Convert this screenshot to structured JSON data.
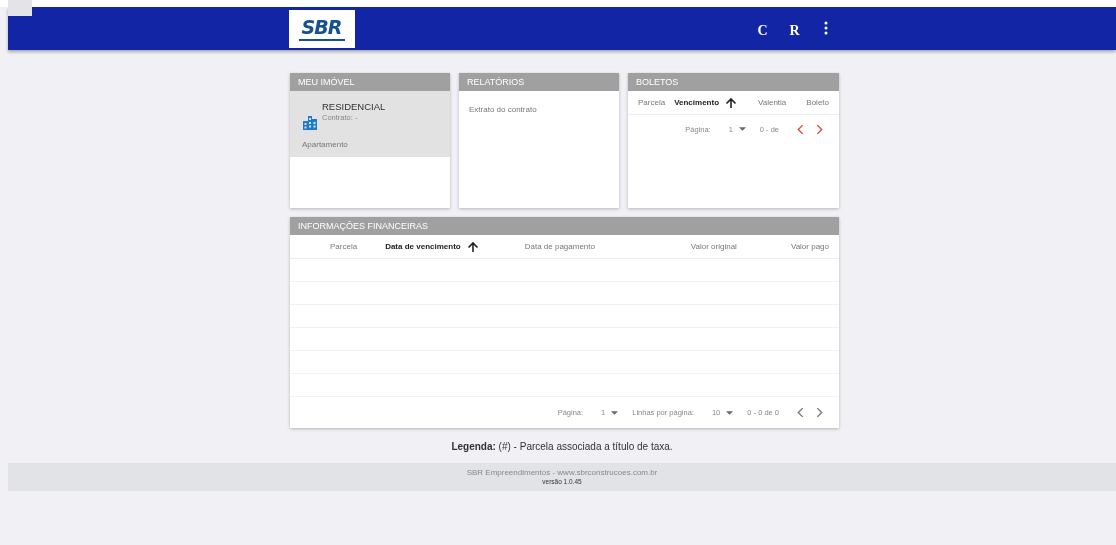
{
  "header": {
    "logo": {
      "text": "SBR"
    },
    "actions": [
      {
        "kind": "letter",
        "label": "C"
      },
      {
        "kind": "letter",
        "label": "R"
      },
      {
        "kind": "more"
      }
    ]
  },
  "meu_imovel": {
    "title": "MEU IMÓVEL",
    "name": "RESIDENCIAL",
    "contract": "Contrato: -",
    "type": "Apartamento"
  },
  "relatorios": {
    "title": "RELATÓRIOS",
    "items": [
      "Extrato do contrato"
    ]
  },
  "boletos": {
    "title": "BOLETOS",
    "columns": [
      {
        "label": "Parcela",
        "sorted": false
      },
      {
        "label": "Vencimento",
        "sorted": true
      },
      {
        "label": "Valentia",
        "sorted": false
      },
      {
        "label": "Boleto",
        "sorted": false
      }
    ],
    "paginator": {
      "page_label": "Página:",
      "page": "1",
      "range": "0 - de",
      "prev_disabled": false,
      "next_disabled": false
    }
  },
  "financeiro": {
    "title": "INFORMAÇÕES FINANCEIRAS",
    "columns": [
      {
        "label": "Parcela",
        "sorted": false
      },
      {
        "label": "Data de vencimento",
        "sorted": true
      },
      {
        "label": "Data de pagamento",
        "sorted": false
      },
      {
        "label": "Valor original",
        "sorted": false
      },
      {
        "label": "Valor pago",
        "sorted": false
      }
    ],
    "paginator": {
      "page_label": "Página:",
      "page": "1",
      "rows_label": "Linhas por página:",
      "rows": "10",
      "range": "0 - 0 de 0",
      "prev_disabled": true,
      "next_disabled": true
    }
  },
  "legend": "**Legenda:**  (#) - Parcela associada a título de taxa.",
  "footer": {
    "company": "SBR Empreendimentos - www.sbrconstrucoes.com.br",
    "version": "versão 1.0.45"
  }
}
